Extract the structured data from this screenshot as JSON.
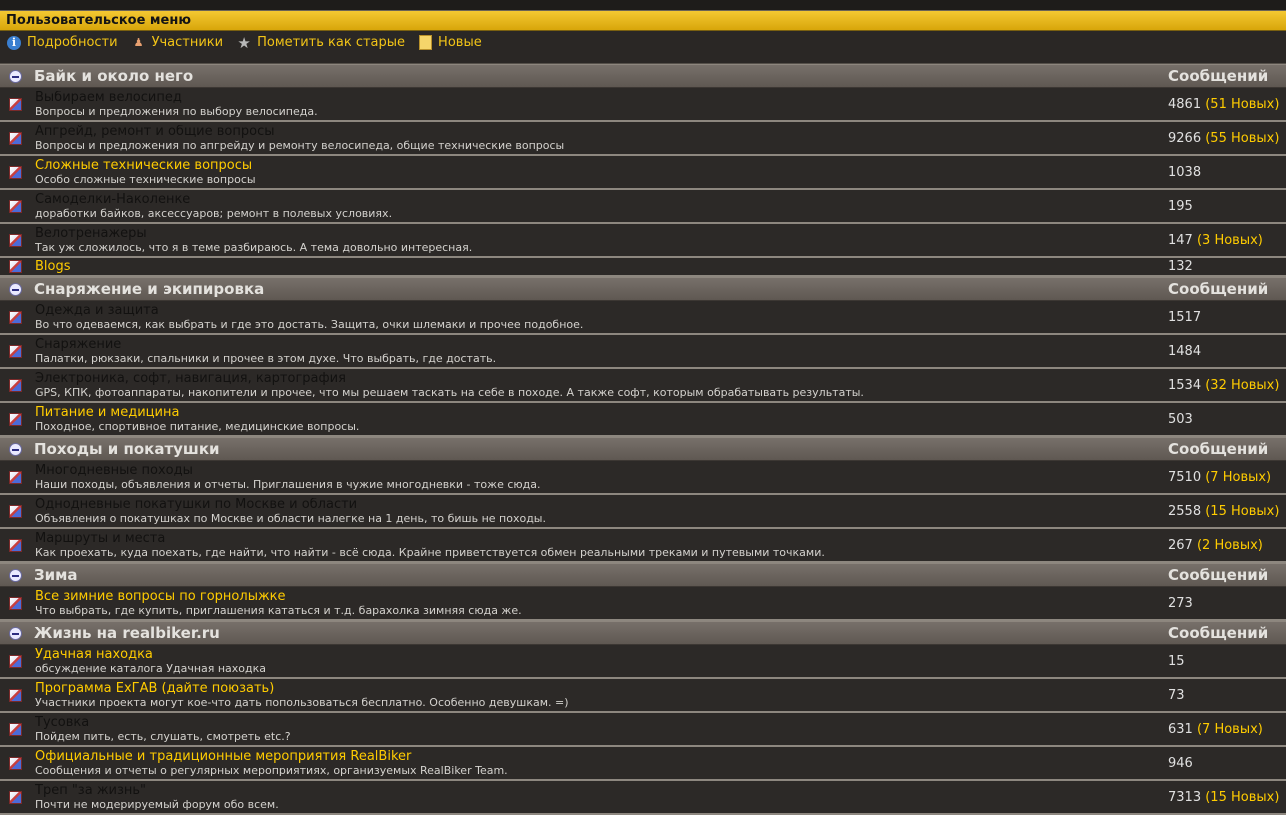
{
  "user_menu": {
    "title": "Пользовательское меню",
    "links": [
      {
        "label": "Подробности",
        "icon": "info-icon"
      },
      {
        "label": "Участники",
        "icon": "users-icon"
      },
      {
        "label": "Пометить как старые",
        "icon": "star-icon"
      },
      {
        "label": "Новые",
        "icon": "new-posts-icon"
      }
    ]
  },
  "colors": {
    "accent": "#ffcc00",
    "menu_bar": "#e7b620",
    "category_bar": "#6a635c",
    "row_bg": "#2c2927"
  },
  "categories": [
    {
      "title": "Байк и около него",
      "posts_header": "Сообщений",
      "forums": [
        {
          "name": "Выбираем велосипед",
          "desc": "Вопросы и предложения по выбору велосипеда.",
          "posts": "4861",
          "new": "(51 Новых)",
          "highlight": false
        },
        {
          "name": "Апгрейд, ремонт и общие вопросы",
          "desc": "Вопросы и предложения по апгрейду и ремонту велосипеда, общие технические вопросы",
          "posts": "9266",
          "new": "(55 Новых)",
          "highlight": false
        },
        {
          "name": "Сложные технические вопросы",
          "desc": "Особо сложные технические вопросы",
          "posts": "1038",
          "new": "",
          "highlight": true
        },
        {
          "name": "Самоделки-Наколенке",
          "desc": "доработки байков, аксессуаров; ремонт в полевых условиях.",
          "posts": "195",
          "new": "",
          "highlight": false
        },
        {
          "name": "Велотренажеры",
          "desc": "Так уж сложилось, что я в теме разбираюсь. А тема довольно интересная.",
          "posts": "147",
          "new": "(3 Новых)",
          "highlight": false
        },
        {
          "name": "Blogs",
          "desc": "",
          "posts": "132",
          "new": "",
          "highlight": true
        }
      ]
    },
    {
      "title": "Снаряжение и экипировка",
      "posts_header": "Сообщений",
      "forums": [
        {
          "name": "Одежда и защита",
          "desc": "Во что одеваемся, как выбрать и где это достать. Защита, очки шлемаки и прочее подобное.",
          "posts": "1517",
          "new": "",
          "highlight": false
        },
        {
          "name": "Снаряжение",
          "desc": "Палатки, рюкзаки, спальники и прочее в этом духе. Что выбрать, где достать.",
          "posts": "1484",
          "new": "",
          "highlight": false
        },
        {
          "name": "Электроника, софт, навигация, картография",
          "desc": "GPS, КПК, фотоаппараты, накопители и прочее, что мы решаем таскать на себе в походе. А также софт, которым обрабатывать результаты.",
          "posts": "1534",
          "new": "(32 Новых)",
          "highlight": false
        },
        {
          "name": "Питание и медицина",
          "desc": "Походное, спортивное питание, медицинские вопросы.",
          "posts": "503",
          "new": "",
          "highlight": true
        }
      ]
    },
    {
      "title": "Походы и покатушки",
      "posts_header": "Сообщений",
      "forums": [
        {
          "name": "Многодневные походы",
          "desc": "Наши походы, объявления и отчеты. Приглашения в чужие многодневки - тоже сюда.",
          "posts": "7510",
          "new": "(7 Новых)",
          "highlight": false
        },
        {
          "name": "Однодневные покатушки по Москве и области",
          "desc": "Объявления о покатушках по Москве и области налегке на 1 день, то бишь не походы.",
          "posts": "2558",
          "new": "(15 Новых)",
          "highlight": false
        },
        {
          "name": "Маршруты и места",
          "desc": "Как проехать, куда поехать, где найти, что найти - всё сюда. Крайне приветствуется обмен реальными треками и путевыми точками.",
          "posts": "267",
          "new": "(2 Новых)",
          "highlight": false
        }
      ]
    },
    {
      "title": "Зима",
      "posts_header": "Сообщений",
      "forums": [
        {
          "name": "Все зимние вопросы по горнолыжке",
          "desc": "Что выбрать, где купить, приглашения кататься и т.д. барахолка зимняя сюда же.",
          "posts": "273",
          "new": "",
          "highlight": true
        }
      ]
    },
    {
      "title": "Жизнь на realbiker.ru",
      "posts_header": "Сообщений",
      "forums": [
        {
          "name": "Удачная находка",
          "desc": "обсуждение каталога Удачная находка",
          "posts": "15",
          "new": "",
          "highlight": true
        },
        {
          "name": "Программа ExГАВ (дайте поюзать)",
          "desc": "Участники проекта могут кое-что дать попользоваться бесплатно. Особенно девушкам. =)",
          "posts": "73",
          "new": "",
          "highlight": true
        },
        {
          "name": "Тусовка",
          "desc": "Пойдем пить, есть, слушать, смотреть etc.?",
          "posts": "631",
          "new": "(7 Новых)",
          "highlight": false
        },
        {
          "name": "Официальные и традиционные мероприятия RealBiker",
          "desc": "Сообщения и отчеты о регулярных мероприятиях, организуемых RealBiker Team.",
          "posts": "946",
          "new": "",
          "highlight": true
        },
        {
          "name": "Треп \"за жизнь\"",
          "desc": "Почти не модерируемый форум обо всем.",
          "posts": "7313",
          "new": "(15 Новых)",
          "highlight": false
        }
      ]
    }
  ]
}
